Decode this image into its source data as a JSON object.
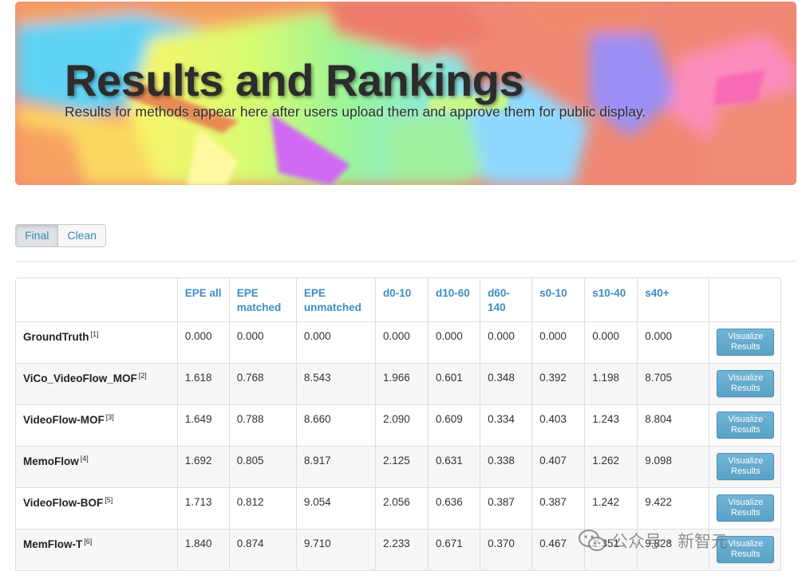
{
  "hero": {
    "title": "Results and Rankings",
    "subtitle": "Results for methods appear here after users upload them and approve them for public display."
  },
  "toggle": {
    "final_label": "Final",
    "clean_label": "Clean",
    "selected": "Final"
  },
  "table": {
    "headers": [
      "",
      "EPE all",
      "EPE matched",
      "EPE unmatched",
      "d0-10",
      "d10-60",
      "d60-140",
      "s0-10",
      "s10-40",
      "s40+",
      ""
    ],
    "visualize_label": "Visualize Results",
    "rows": [
      {
        "method": "GroundTruth",
        "ref": "[1]",
        "values": [
          "0.000",
          "0.000",
          "0.000",
          "0.000",
          "0.000",
          "0.000",
          "0.000",
          "0.000",
          "0.000"
        ]
      },
      {
        "method": "ViCo_VideoFlow_MOF",
        "ref": "[2]",
        "values": [
          "1.618",
          "0.768",
          "8.543",
          "1.966",
          "0.601",
          "0.348",
          "0.392",
          "1.198",
          "8.705"
        ]
      },
      {
        "method": "VideoFlow-MOF",
        "ref": "[3]",
        "values": [
          "1.649",
          "0.788",
          "8.660",
          "2.090",
          "0.609",
          "0.334",
          "0.403",
          "1.243",
          "8.804"
        ]
      },
      {
        "method": "MemoFlow",
        "ref": "[4]",
        "values": [
          "1.692",
          "0.805",
          "8.917",
          "2.125",
          "0.631",
          "0.338",
          "0.407",
          "1.262",
          "9.098"
        ]
      },
      {
        "method": "VideoFlow-BOF",
        "ref": "[5]",
        "values": [
          "1.713",
          "0.812",
          "9.054",
          "2.056",
          "0.636",
          "0.387",
          "0.387",
          "1.242",
          "9.422"
        ]
      },
      {
        "method": "MemFlow-T",
        "ref": "[6]",
        "values": [
          "1.840",
          "0.874",
          "9.710",
          "2.233",
          "0.671",
          "0.370",
          "0.467",
          "1.351",
          "9.828"
        ]
      }
    ]
  },
  "watermark": {
    "text": "公众号 · 新智元",
    "icon": "wechat-icon"
  },
  "colors": {
    "link": "#3e8ec2",
    "button": "#5aa2c6",
    "stripe": "#f7f7f7"
  }
}
